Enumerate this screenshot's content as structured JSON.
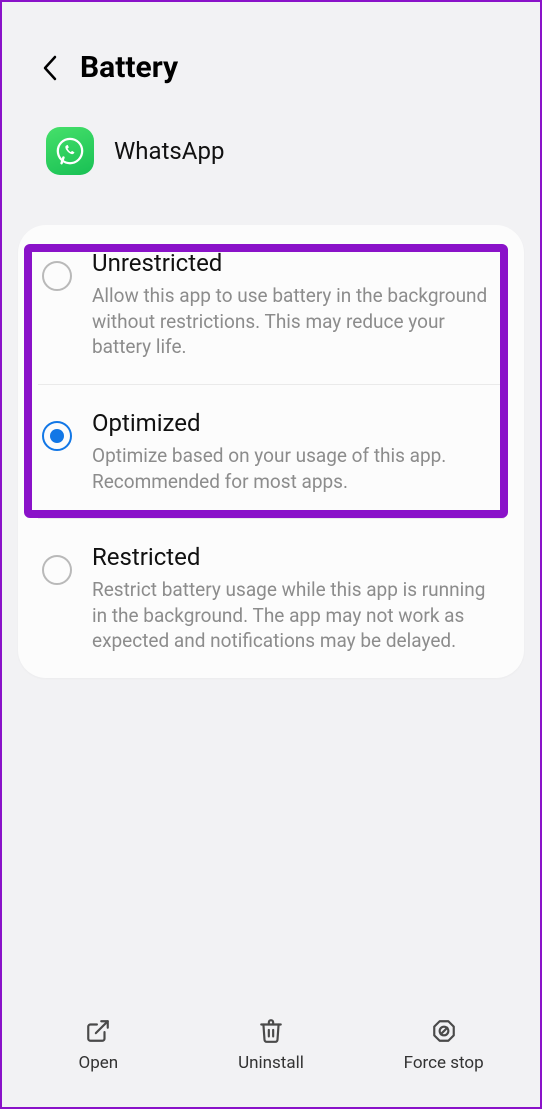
{
  "header": {
    "title": "Battery"
  },
  "app": {
    "name": "WhatsApp"
  },
  "options": [
    {
      "title": "Unrestricted",
      "desc": "Allow this app to use battery in the background without restrictions. This may reduce your battery life.",
      "selected": false
    },
    {
      "title": "Optimized",
      "desc": "Optimize based on your usage of this app. Recommended for most apps.",
      "selected": true
    },
    {
      "title": "Restricted",
      "desc": "Restrict battery usage while this app is running in the background. The app may not work as expected and notifications may be delayed.",
      "selected": false
    }
  ],
  "nav": {
    "open": "Open",
    "uninstall": "Uninstall",
    "forcestop": "Force stop"
  }
}
